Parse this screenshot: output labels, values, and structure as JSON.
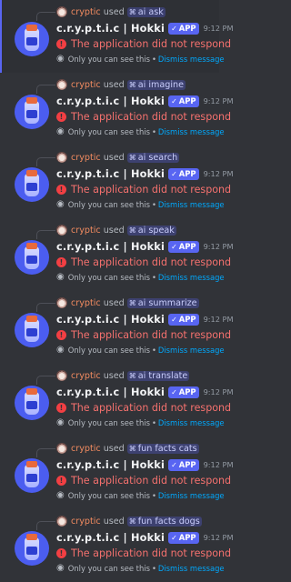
{
  "colors": {
    "background": "#313338",
    "accent": "#5865f2",
    "error": "#f23f43",
    "link": "#00a8fc",
    "username": "#f28b60"
  },
  "icons": {
    "app_check": "✓",
    "command": "⌘",
    "error": "!",
    "eye": "◉"
  },
  "messages": [
    {
      "user": "cryptic",
      "used": "used",
      "command": "ai ask",
      "bot_name": "c.r.y.p.t.i.c | Hokki",
      "badge": "APP",
      "time": "9:12 PM",
      "error": "The application did not respond",
      "eph_text": "Only you can see this",
      "sep": "•",
      "dismiss": "Dismiss message"
    },
    {
      "user": "cryptic",
      "used": "used",
      "command": "ai imagine",
      "bot_name": "c.r.y.p.t.i.c | Hokki",
      "badge": "APP",
      "time": "9:12 PM",
      "error": "The application did not respond",
      "eph_text": "Only you can see this",
      "sep": "•",
      "dismiss": "Dismiss message"
    },
    {
      "user": "cryptic",
      "used": "used",
      "command": "ai search",
      "bot_name": "c.r.y.p.t.i.c | Hokki",
      "badge": "APP",
      "time": "9:12 PM",
      "error": "The application did not respond",
      "eph_text": "Only you can see this",
      "sep": "•",
      "dismiss": "Dismiss message"
    },
    {
      "user": "cryptic",
      "used": "used",
      "command": "ai speak",
      "bot_name": "c.r.y.p.t.i.c | Hokki",
      "badge": "APP",
      "time": "9:12 PM",
      "error": "The application did not respond",
      "eph_text": "Only you can see this",
      "sep": "•",
      "dismiss": "Dismiss message"
    },
    {
      "user": "cryptic",
      "used": "used",
      "command": "ai summarize",
      "bot_name": "c.r.y.p.t.i.c | Hokki",
      "badge": "APP",
      "time": "9:12 PM",
      "error": "The application did not respond",
      "eph_text": "Only you can see this",
      "sep": "•",
      "dismiss": "Dismiss message"
    },
    {
      "user": "cryptic",
      "used": "used",
      "command": "ai translate",
      "bot_name": "c.r.y.p.t.i.c | Hokki",
      "badge": "APP",
      "time": "9:12 PM",
      "error": "The application did not respond",
      "eph_text": "Only you can see this",
      "sep": "•",
      "dismiss": "Dismiss message"
    },
    {
      "user": "cryptic",
      "used": "used",
      "command": "fun facts cats",
      "bot_name": "c.r.y.p.t.i.c | Hokki",
      "badge": "APP",
      "time": "9:12 PM",
      "error": "The application did not respond",
      "eph_text": "Only you can see this",
      "sep": "•",
      "dismiss": "Dismiss message"
    },
    {
      "user": "cryptic",
      "used": "used",
      "command": "fun facts dogs",
      "bot_name": "c.r.y.p.t.i.c | Hokki",
      "badge": "APP",
      "time": "9:12 PM",
      "error": "The application did not respond",
      "eph_text": "Only you can see this",
      "sep": "•",
      "dismiss": "Dismiss message"
    }
  ]
}
